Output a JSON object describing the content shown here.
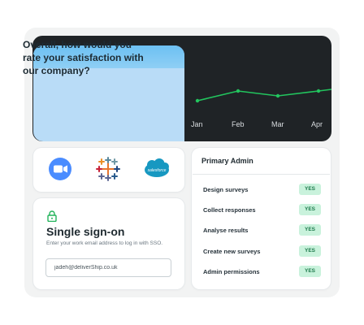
{
  "question_card": {
    "text": "Overall, how would you rate your satisfaction with our company?"
  },
  "chart_data": {
    "type": "line",
    "categories": [
      "Jan",
      "Feb",
      "Mar",
      "Apr"
    ],
    "series": [
      {
        "values": [
          2.0,
          2.6,
          2.3,
          2.6
        ]
      }
    ],
    "ylim": [
      0,
      5
    ],
    "grid": false,
    "color": "#22c55e"
  },
  "integrations": [
    {
      "name": "zoom-icon"
    },
    {
      "name": "tableau-icon"
    },
    {
      "name": "salesforce-icon",
      "label": "salesforce"
    }
  ],
  "sso": {
    "title": "Single sign-on",
    "description": "Enter your work email address to log in with SSO.",
    "email_value": "jadeh@deliverShip.co.uk"
  },
  "admin": {
    "title": "Primary Admin",
    "permissions": [
      {
        "label": "Design surveys",
        "status": "YES"
      },
      {
        "label": "Collect responses",
        "status": "YES"
      },
      {
        "label": "Analyse results",
        "status": "YES"
      },
      {
        "label": "Create new surveys",
        "status": "YES"
      },
      {
        "label": "Admin permissions",
        "status": "YES"
      }
    ]
  },
  "colors": {
    "chart_bg": "#1f2326",
    "question_bg": "#b9dcf7",
    "accent_green": "#22c55e",
    "badge_bg": "#c9f2dc",
    "badge_text": "#1d7a4b"
  }
}
